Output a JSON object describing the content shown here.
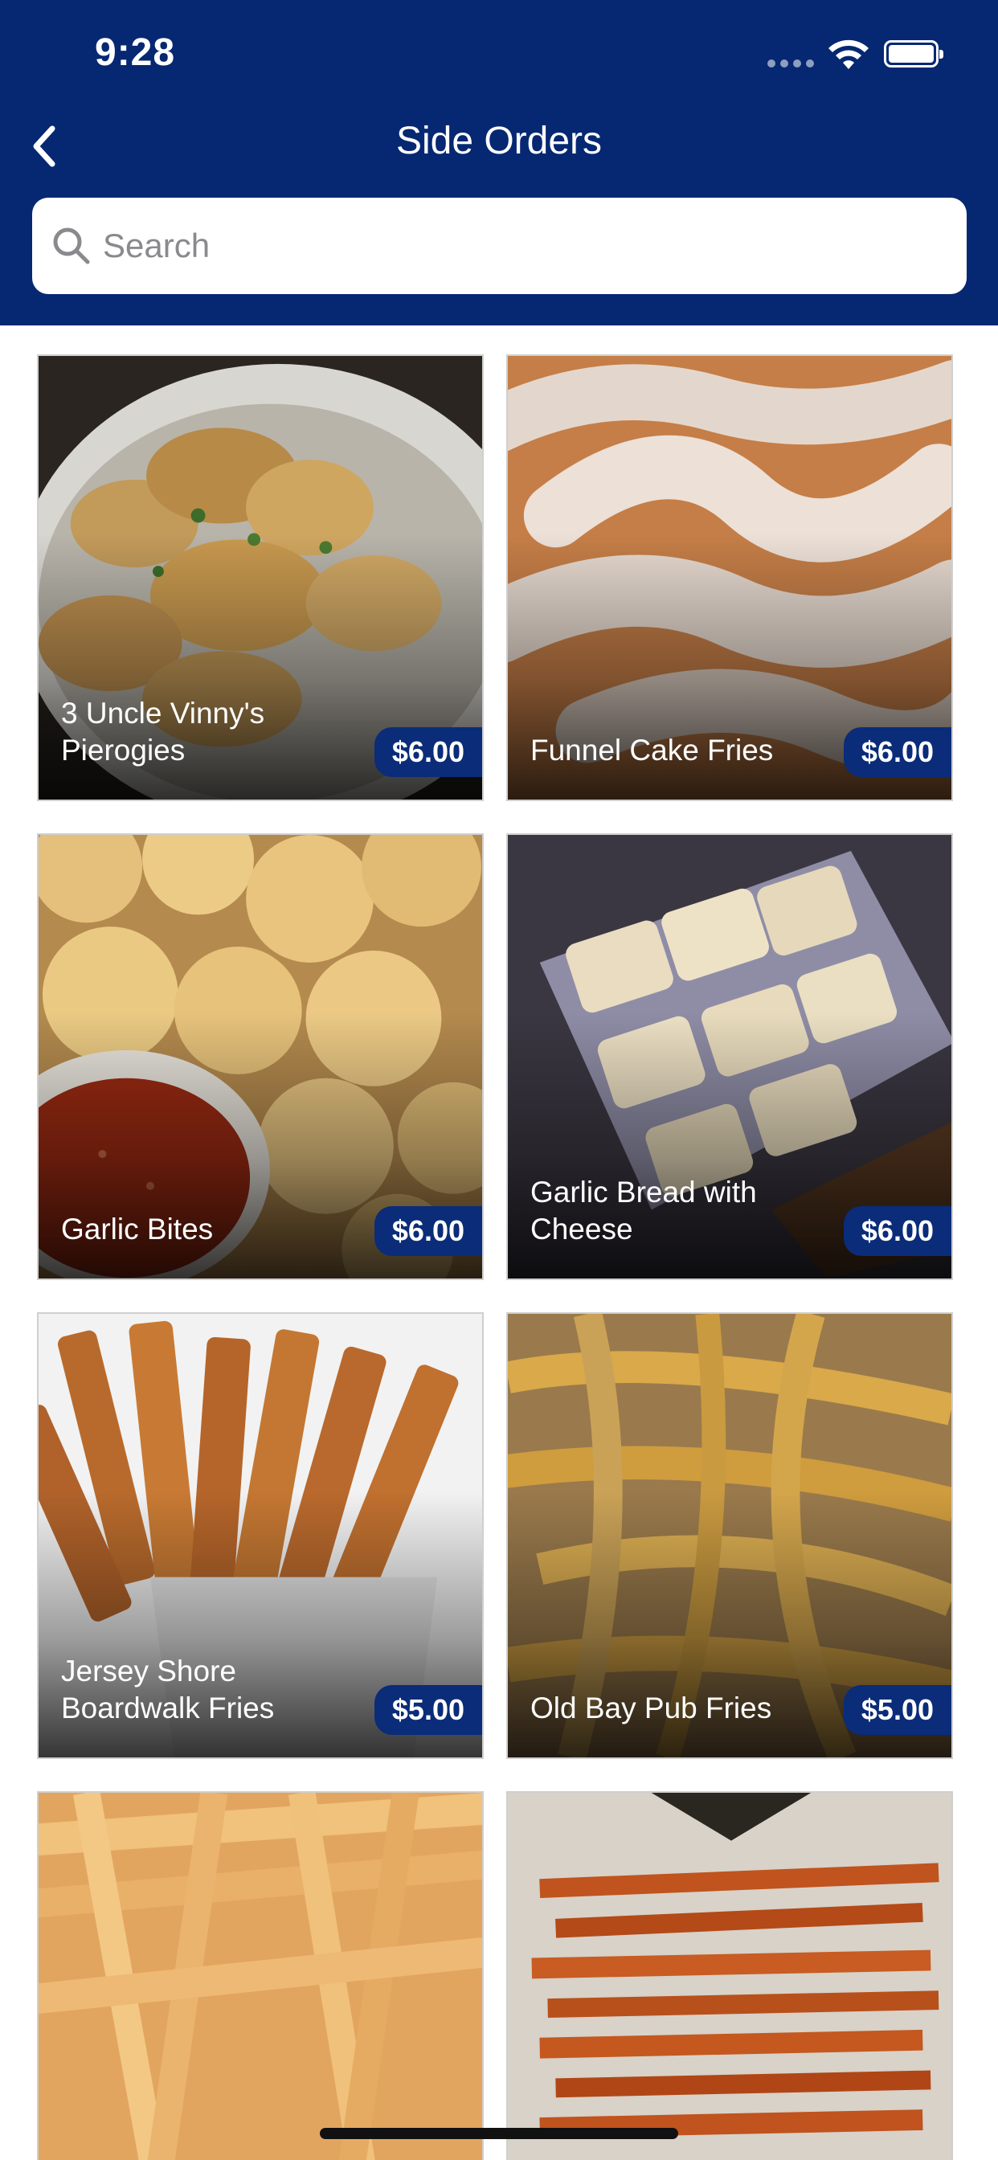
{
  "status_bar": {
    "time": "9:28"
  },
  "header": {
    "title": "Side Orders"
  },
  "search": {
    "placeholder": "Search",
    "value": ""
  },
  "items": [
    {
      "name": "3 Uncle Vinny's Pierogies",
      "price": "$6.00"
    },
    {
      "name": "Funnel Cake Fries",
      "price": "$6.00"
    },
    {
      "name": "Garlic Bites",
      "price": "$6.00"
    },
    {
      "name": "Garlic Bread with Cheese",
      "price": "$6.00"
    },
    {
      "name": "Jersey Shore Boardwalk Fries",
      "price": "$5.00"
    },
    {
      "name": "Old Bay Pub Fries",
      "price": "$5.00"
    }
  ],
  "colors": {
    "brand_navy": "#062872",
    "price_badge": "#0a2c79"
  }
}
